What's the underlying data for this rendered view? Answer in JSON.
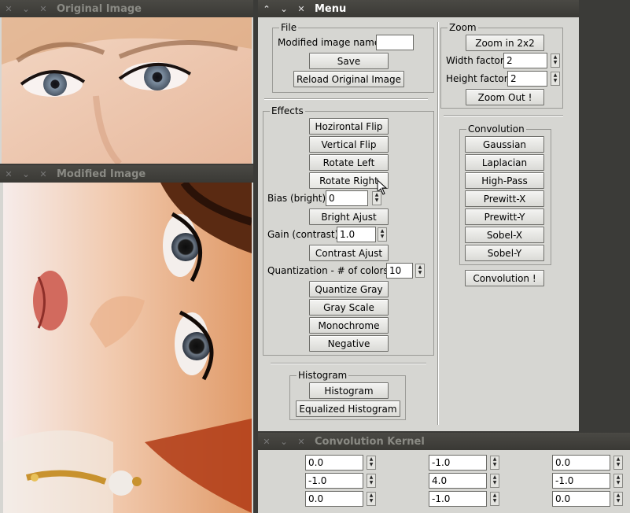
{
  "windows": {
    "original": {
      "title": "Original Image"
    },
    "modified": {
      "title": "Modified Image"
    },
    "menu": {
      "title": "Menu"
    },
    "kernel": {
      "title": "Convolution Kernel"
    }
  },
  "titlebar_icons": [
    "chevron-up-icon",
    "chevron-down-icon",
    "close-icon"
  ],
  "menu": {
    "file": {
      "legend": "File",
      "name_label": "Modified image name:",
      "name_value": "",
      "save": "Save",
      "reload": "Reload Original Image"
    },
    "zoom": {
      "legend": "Zoom",
      "zoom_in": "Zoom in 2x2",
      "width_label": "Width factor:",
      "width_value": "2",
      "height_label": "Height factor:",
      "height_value": "2",
      "zoom_out": "Zoom Out !"
    },
    "effects": {
      "legend": "Effects",
      "hflip": "Hozirontal Flip",
      "vflip": "Vertical Flip",
      "rot_left": "Rotate Left",
      "rot_right": "Rotate Right",
      "bias_label": "Bias (bright):",
      "bias_value": "0",
      "bright": "Bright Ajust",
      "gain_label": "Gain (contrast):",
      "gain_value": "1.0",
      "contrast": "Contrast Ajust",
      "quant_label": "Quantization - # of colors:",
      "quant_value": "10",
      "quant_gray": "Quantize Gray",
      "gray": "Gray Scale",
      "mono": "Monochrome",
      "negative": "Negative"
    },
    "convolution": {
      "legend": "Convolution",
      "gaussian": "Gaussian",
      "laplacian": "Laplacian",
      "highpass": "High-Pass",
      "prewitt_x": "Prewitt-X",
      "prewitt_y": "Prewitt-Y",
      "sobel_x": "Sobel-X",
      "sobel_y": "Sobel-Y",
      "apply": "Convolution !"
    },
    "histogram": {
      "legend": "Histogram",
      "histogram": "Histogram",
      "equalized": "Equalized Histogram"
    }
  },
  "kernel": {
    "values": [
      "0.0",
      "-1.0",
      "0.0",
      "-1.0",
      "4.0",
      "-1.0",
      "0.0",
      "-1.0",
      "0.0"
    ]
  },
  "colors": {
    "window_bg": "#d6d6d2",
    "titlebar": "#3c3b37",
    "desktop": "#3b3b38"
  }
}
